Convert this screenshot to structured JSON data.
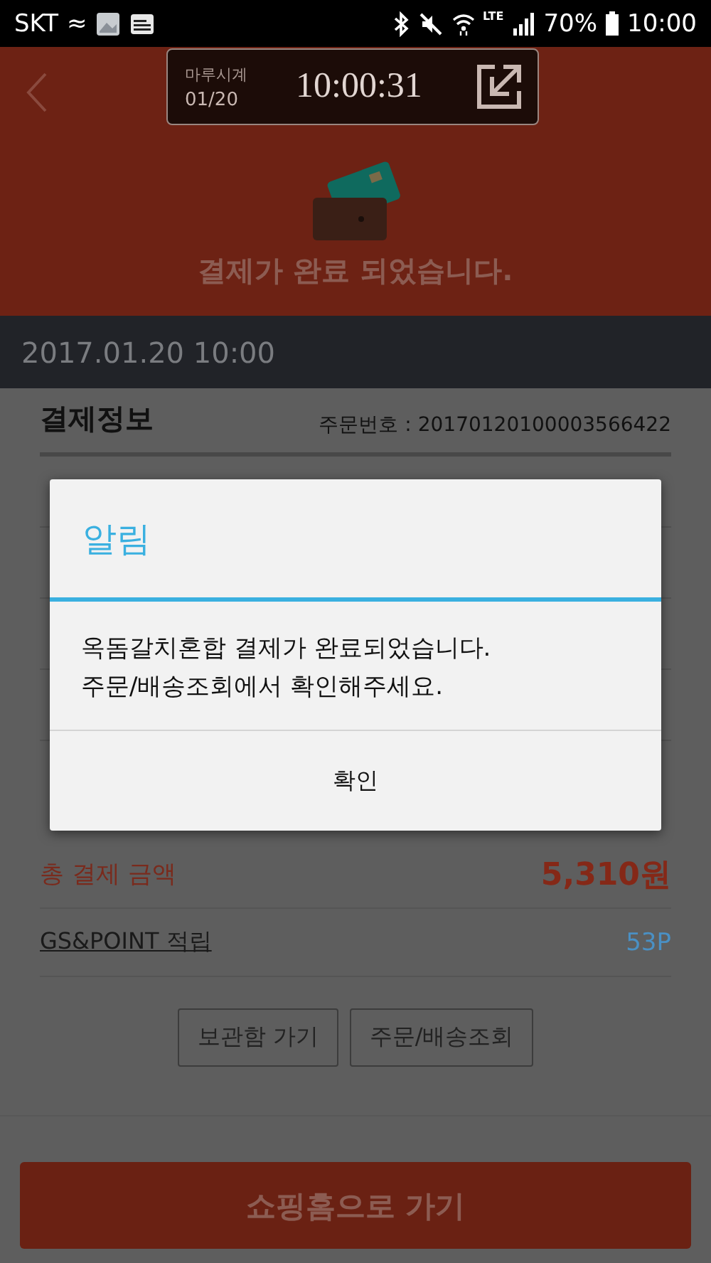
{
  "status_bar": {
    "carrier": "SKT",
    "network_symbol": "≈",
    "lte": "LTE",
    "battery": "70%",
    "time": "10:00"
  },
  "clock_widget": {
    "name": "마루시계",
    "date": "01/20",
    "time": "10:00:31"
  },
  "header": {
    "message": "결제가 완료 되었습니다."
  },
  "date_bar": {
    "text": "2017.01.20 10:00"
  },
  "payment_info": {
    "title": "결제정보",
    "order_number": "주문번호 : 20170120100003566422",
    "total_label": "총 결제 금액",
    "total_value": "5,310원",
    "points_label": "GS&POINT 적립",
    "points_value": "53P"
  },
  "buttons": [
    "보관함 가기",
    "주문/배송조회"
  ],
  "main_button": "쇼핑홈으로 가기",
  "dialog": {
    "title": "알림",
    "message_lines": [
      "옥돔갈치혼합 결제가 완료되었습니다.",
      "주문/배송조회에서 확인해주세요."
    ],
    "confirm": "확인"
  }
}
